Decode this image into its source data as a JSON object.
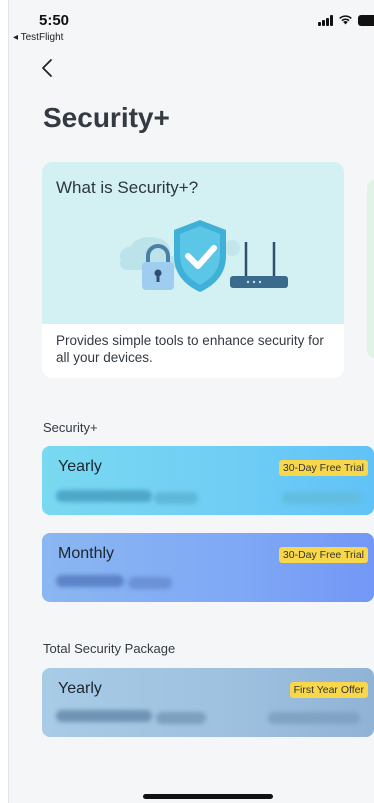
{
  "status_bar": {
    "time": "5:50",
    "back_app": "◂ TestFlight"
  },
  "nav": {
    "back_icon": "chevron-left-icon",
    "title": "Security+"
  },
  "info_card": {
    "title": "What is Security+?",
    "description": "Provides simple tools to enhance security for all your devices.",
    "illustration": "shield-lock-router-illustration"
  },
  "sections": [
    {
      "label": "Security+",
      "plans": [
        {
          "name": "Yearly",
          "badge": "30-Day Free Trial"
        },
        {
          "name": "Monthly",
          "badge": "30-Day Free Trial"
        }
      ]
    },
    {
      "label": "Total Security Package",
      "plans": [
        {
          "name": "Yearly",
          "badge": "First Year Offer"
        }
      ]
    }
  ],
  "colors": {
    "page_bg": "#f5f6f7",
    "info_card_top": "#d3f0f3",
    "yearly_card": "#6fcdf5",
    "monthly_card": "#7fa8f5",
    "tsp_card": "#9dc0df",
    "badge": "#f8d84a"
  }
}
